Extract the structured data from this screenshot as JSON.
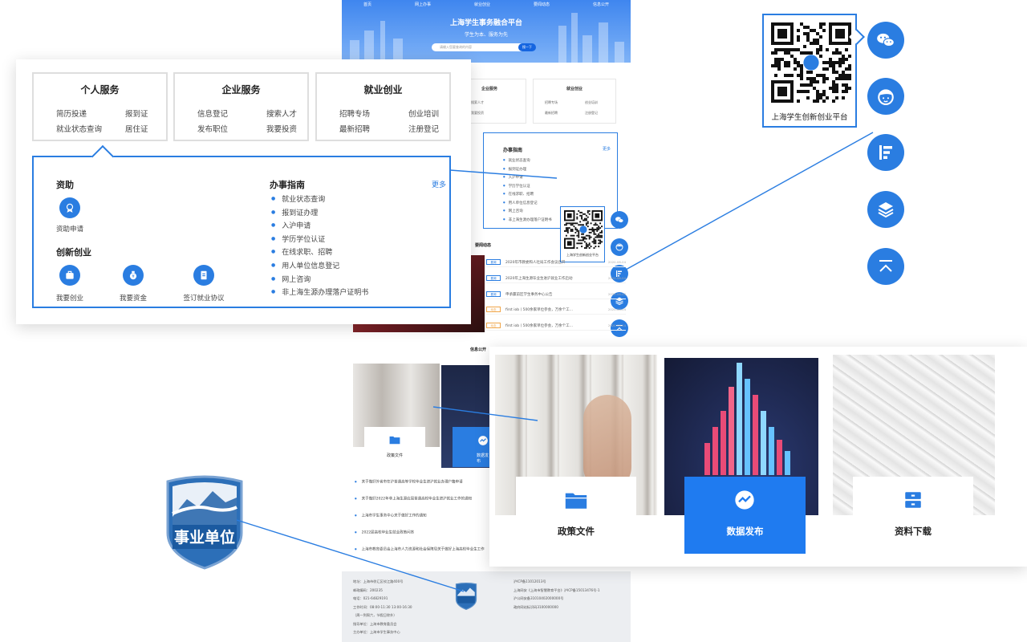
{
  "site": {
    "nav": [
      "首页",
      "网上办事",
      "就业创业",
      "要闻动态",
      "信息公开"
    ],
    "title": "上海学生事务融合平台",
    "slogan": "学生为本、服务为先",
    "search_placeholder": "请输入您要查询的内容",
    "search_button": "搜一下"
  },
  "services": {
    "personal": {
      "title": "个人服务",
      "items": [
        "简历投递",
        "报到证",
        "就业状态查询",
        "居住证"
      ]
    },
    "enterprise": {
      "title": "企业服务",
      "items": [
        "信息登记",
        "搜索人才",
        "发布职位",
        "我要投资"
      ]
    },
    "employment": {
      "title": "就业创业",
      "items": [
        "招聘专场",
        "创业培训",
        "最新招聘",
        "注册登记"
      ]
    }
  },
  "guide_panel": {
    "subsidy_title": "资助",
    "subsidy_item": "资助申请",
    "startup_title": "创新创业",
    "startup_items": [
      "我要创业",
      "我要资金",
      "签订就业协议"
    ],
    "guide_title": "办事指南",
    "more": "更多",
    "guide_items": [
      "就业状态查询",
      "报到证办理",
      "入沪申请",
      "学历学位认证",
      "在线求职、招聘",
      "用人单位信息登记",
      "网上咨询",
      "非上海生源办理落户证明书"
    ]
  },
  "qr": {
    "caption": "上海学生创新创业平台"
  },
  "sidebar_icons": [
    "wechat-icon",
    "service-avatar-icon",
    "chart-icon",
    "layers-icon",
    "back-to-top-icon"
  ],
  "news": {
    "title": "要闻动态",
    "items": [
      {
        "tag": "要闻",
        "text": "2020年市教委和人社局工作会议召开",
        "date": "2020-08-04"
      },
      {
        "tag": "要闻",
        "text": "2020年上海生源毕业生进沪就业工作启动",
        "date": "2020-08-04"
      },
      {
        "tag": "要闻",
        "text": "申承赢前区学生事务中心公告",
        "date": "2020-08-04"
      },
      {
        "tag": "动态",
        "text": "first iob丨500余家单位参会，万余个工…",
        "date": "2020-08-04"
      },
      {
        "tag": "动态",
        "text": "first iob丨500余家单位参会，万余个工…",
        "date": "2020-08-04"
      }
    ]
  },
  "info": {
    "title": "信息公开",
    "cards": [
      "政策文件",
      "数据发布",
      "资料下载"
    ],
    "list": [
      "关于做好外省市在沪普通高等学校毕业生进沪就业办理户籍申请",
      "关于做好2022年非上海生源应届普通高校毕业生进沪就业工作的通知",
      "上海市学生事务中心关于做好工作的通知",
      "2022届高校毕业生就业政策问答",
      "上海市教育委员会上海市人力资源和社会保障局关于做好上海高校毕业生工作"
    ]
  },
  "footer": {
    "left": [
      "地址：上海市徐汇区钦江路400号",
      "邮政编码：200235",
      "电话：021-64829191",
      "工作时间：08:00-11:30 13:00-16:30",
      "（周一到周六，节假日除外）",
      "指导单位：上海市教育委员会",
      "主办单位：上海市学生事务中心"
    ],
    "right": [
      "沪ICP备11012013号",
      "上海网安《上海市智慧教育平台》沪ICP备15013476号-1",
      "沪公网安备31010402000000号",
      "政府网站标识码3100000000"
    ]
  },
  "badge": {
    "text": "事业单位"
  },
  "colors": {
    "primary": "#2a7de1",
    "card_blue": "#1f7bf0",
    "tag_orange": "#f0a64a"
  }
}
